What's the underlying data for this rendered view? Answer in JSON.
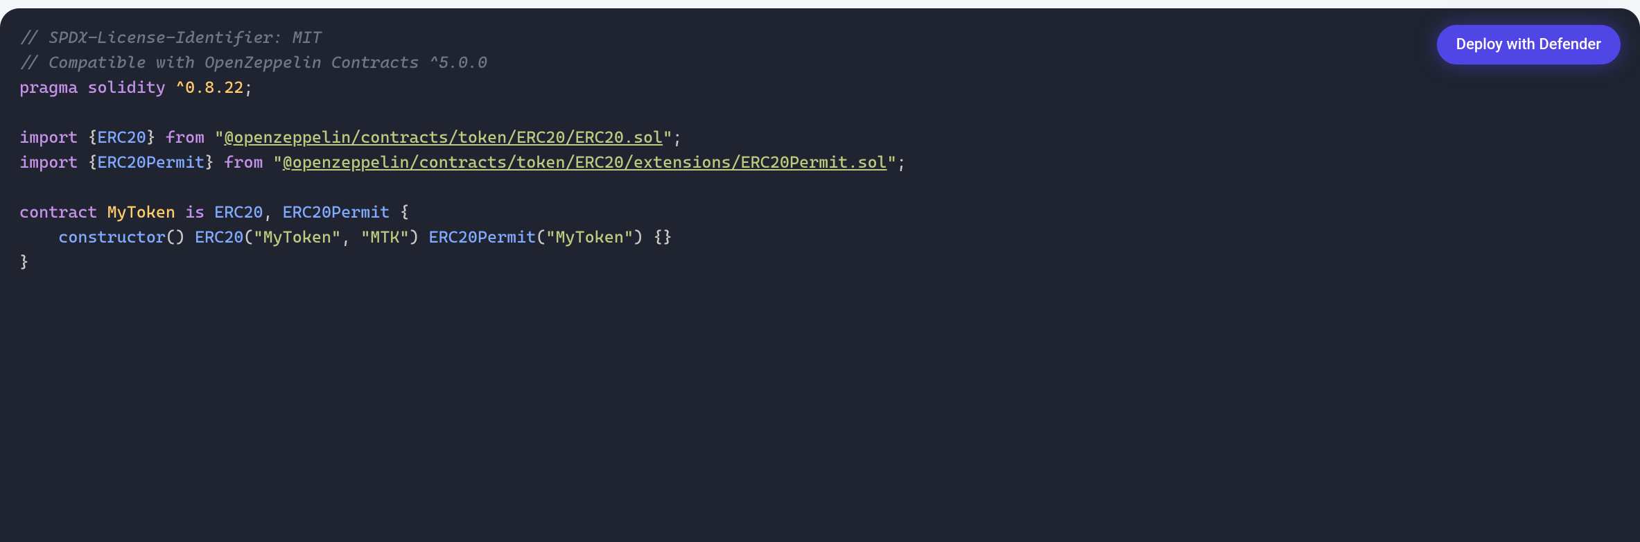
{
  "button": {
    "deploy_label": "Deploy with Defender"
  },
  "code": {
    "line1_comment": "// SPDX-License-Identifier: MIT",
    "line2_comment": "// Compatible with OpenZeppelin Contracts ^5.0.0",
    "line3": {
      "pragma": "pragma",
      "solidity": "solidity",
      "version": "^0.8.22",
      "semi": ";"
    },
    "line5": {
      "import": "import",
      "open_brace": " {",
      "type": "ERC20",
      "close_brace": "}",
      "from": "from",
      "quote1": " \"",
      "path": "@openzeppelin/contracts/token/ERC20/ERC20.sol",
      "quote2": "\"",
      "semi": ";"
    },
    "line6": {
      "import": "import",
      "open_brace": " {",
      "type": "ERC20Permit",
      "close_brace": "}",
      "from": "from",
      "quote1": " \"",
      "path": "@openzeppelin/contracts/token/ERC20/extensions/ERC20Permit.sol",
      "quote2": "\"",
      "semi": ";"
    },
    "line8": {
      "contract": "contract",
      "name": " MyToken",
      "is": "is",
      "base1": "ERC20",
      "comma": ", ",
      "base2": "ERC20Permit",
      "open": " {"
    },
    "line9": {
      "indent": "    ",
      "constructor": "constructor",
      "parens": "()",
      "erc20": "ERC20",
      "erc20_args_open": "(",
      "erc20_arg1": "\"MyToken\"",
      "erc20_comma": ", ",
      "erc20_arg2": "\"MTK\"",
      "erc20_args_close": ")",
      "permit": "ERC20Permit",
      "permit_args_open": "(",
      "permit_arg1": "\"MyToken\"",
      "permit_args_close": ")",
      "body": " {}"
    },
    "line10": {
      "close": "}"
    }
  }
}
